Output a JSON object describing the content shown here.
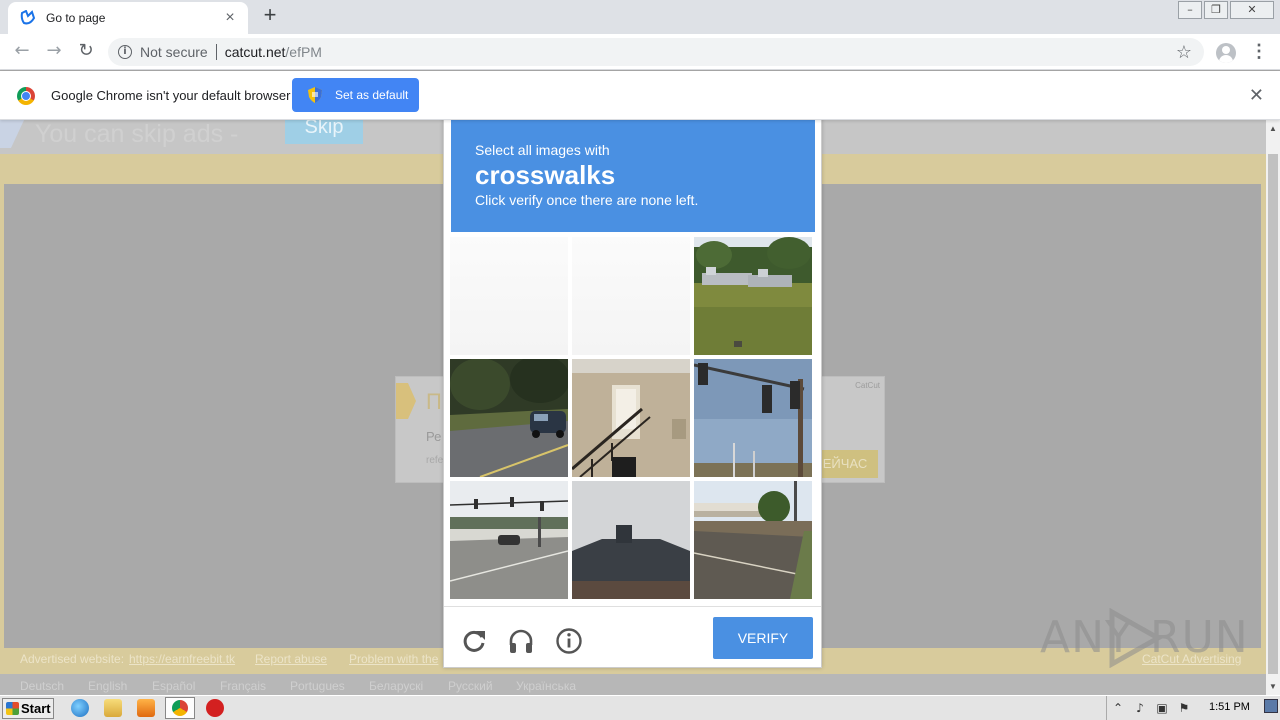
{
  "browser": {
    "tab_title": "Go to page",
    "tab_close": "×",
    "new_tab": "+",
    "window_controls": [
      "–",
      "❐",
      "✕"
    ],
    "security": "Not secure",
    "url_host": "catcut.net",
    "url_path": "/efPM",
    "back": "←",
    "forward": "→",
    "reload": "↻",
    "star": "☆",
    "menu": "⋮"
  },
  "infobar": {
    "message": "Google Chrome isn't your default browser",
    "button": "Set as default",
    "close": "✕"
  },
  "page": {
    "skip_text": "You can skip ads  -",
    "skip_button": "Skip",
    "ad_title": "П",
    "ad_line1": "Ре",
    "ad_line2": "refe",
    "ad_brand": "CatCut",
    "ad_button": "ЕЙЧАС",
    "footer_advertised": "Advertised website:",
    "footer_link": "https://earnfreebit.tk",
    "footer_report": "Report abuse",
    "footer_problem": "Problem with the",
    "footer_catcut": "CatCut Advertising",
    "languages": [
      "Deutsch",
      "English",
      "Español",
      "Français",
      "Portugues",
      "Беларускі",
      "Русский",
      "Українська"
    ]
  },
  "captcha": {
    "instruction": "Select all images with",
    "keyword": "crosswalks",
    "subinstruction": "Click verify once there are none left.",
    "verify": "VERIFY",
    "tiles": [
      {
        "scene": "blank"
      },
      {
        "scene": "blank"
      },
      {
        "scene": "boats-on-grass"
      },
      {
        "scene": "road-with-car"
      },
      {
        "scene": "building-stairs"
      },
      {
        "scene": "traffic-lights"
      },
      {
        "scene": "intersection"
      },
      {
        "scene": "house-roof"
      },
      {
        "scene": "road-shops"
      }
    ]
  },
  "watermark": {
    "left": "ANY",
    "right": "RUN"
  },
  "taskbar": {
    "start": "Start",
    "clock": "1:51 PM"
  }
}
